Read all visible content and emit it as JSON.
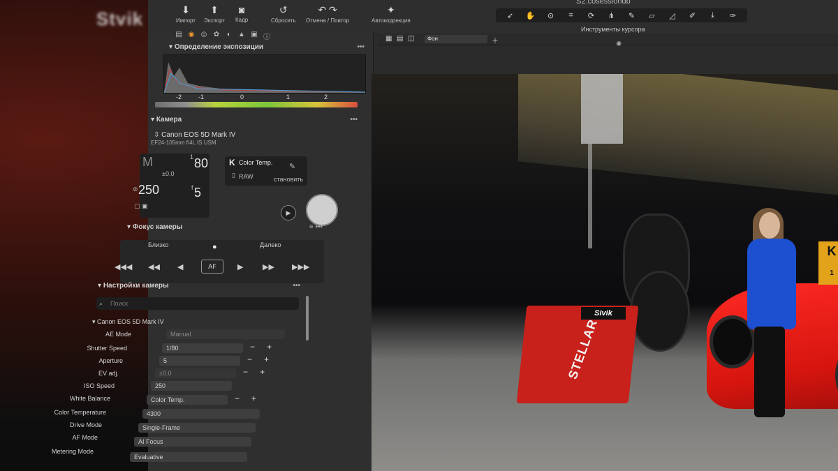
{
  "toolbar": {
    "session": " S2.cosessiondb",
    "buttons": [
      {
        "label": "Импорт",
        "icon": "import-icon"
      },
      {
        "label": "Экспорт",
        "icon": "export-icon"
      },
      {
        "label": "Кадр",
        "icon": "camera-icon"
      },
      {
        "label": "Сбросить",
        "icon": "reset-icon"
      },
      {
        "label": "Отмена / Повтор",
        "icon": "undo-redo-icon"
      },
      {
        "label": "Автокоррекция",
        "icon": "magic-wand-icon"
      }
    ],
    "cursor_tools_label": "Инструменты курсора"
  },
  "exposure": {
    "title": "Определение экспозиции",
    "scale": [
      "-2",
      "-1",
      "0",
      "1",
      "2"
    ]
  },
  "camera": {
    "title": "Камера",
    "model": "Canon EOS 5D Mark IV",
    "lens": "EF24-105mm f/4L IS USM",
    "mode": "M",
    "shutter_num": "1",
    "shutter_den": "80",
    "ev": "±0.0",
    "iso": "250",
    "aperture": "5",
    "wb_mode": "Color Temp.",
    "wb_letter": "K",
    "format": "RAW",
    "wb_action": "становить"
  },
  "focus": {
    "title": "Фокус камеры",
    "near": "Близко",
    "far": "Далеко",
    "af": "AF"
  },
  "settings": {
    "title": "Настройки камеры",
    "search_placeholder": "Поиск",
    "camera_group": "Canon EOS 5D Mark IV",
    "rows": [
      {
        "label": "AE Mode",
        "value": "Manual"
      },
      {
        "label": "Shutter Speed",
        "value": "1/80"
      },
      {
        "label": "Aperture",
        "value": "5"
      },
      {
        "label": "EV adj.",
        "value": "±0.0"
      },
      {
        "label": "ISO Speed",
        "value": "250"
      },
      {
        "label": "White Balance",
        "value": "Color Temp."
      },
      {
        "label": "Color Temperature",
        "value": "4300"
      },
      {
        "label": "Drive Mode",
        "value": "Single-Frame"
      },
      {
        "label": "AF Mode",
        "value": "AI Focus"
      },
      {
        "label": "Metering Mode",
        "value": "Evaluative"
      }
    ]
  },
  "viewer": {
    "background_label": "Фон"
  },
  "photo": {
    "balancer_brand": "Sivik",
    "balancer_model": "STELLAR",
    "sign": "K",
    "sign_num": "1"
  },
  "colors": {
    "accent": "#f39a2c",
    "panel": "#2f2f2f",
    "car_red": "#e01b14",
    "jacket_blue": "#1d4fd1"
  }
}
